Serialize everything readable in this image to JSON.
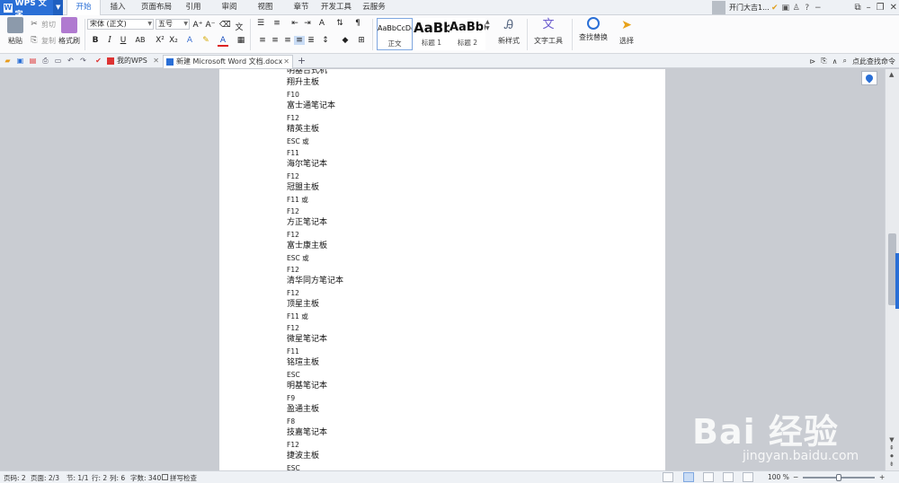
{
  "app": {
    "name": "WPS 文字"
  },
  "menu": {
    "tabs": [
      "开始",
      "插入",
      "页面布局",
      "引用",
      "审阅",
      "视图",
      "章节",
      "开发工具",
      "云服务"
    ],
    "active_tab": "开始"
  },
  "user": {
    "name": "开门大吉1..."
  },
  "ribbon": {
    "paste": "粘贴",
    "cut": "剪切",
    "copy": "复制",
    "format_painter": "格式刷",
    "font_name": "宋体 (正文)",
    "font_size": "五号",
    "styles": [
      {
        "preview": "AaBbCcDd",
        "label": "正文"
      },
      {
        "preview": "AaBb",
        "label": "标题 1"
      },
      {
        "preview": "AaBb(",
        "label": "标题 2"
      }
    ],
    "new_style": "新样式",
    "text_tools": "文字工具",
    "find_replace": "查找替换",
    "select": "选择"
  },
  "tabs_bar": {
    "my_wps": "我的WPS",
    "doc_name": "新建 Microsoft Word 文档.docx",
    "add": "+",
    "search_cmd": "点此查找命令"
  },
  "document": {
    "lines": [
      {
        "t": "明基台式机",
        "k": "cn"
      },
      {
        "t": "翔升主板",
        "k": "cn"
      },
      {
        "t": "F10",
        "k": "key"
      },
      {
        "t": "富士通笔记本",
        "k": "cn"
      },
      {
        "t": "F12",
        "k": "key"
      },
      {
        "t": "精英主板",
        "k": "cn"
      },
      {
        "t": "ESC 或",
        "k": "key"
      },
      {
        "t": "F11",
        "k": "key"
      },
      {
        "t": "海尔笔记本",
        "k": "cn"
      },
      {
        "t": "F12",
        "k": "key"
      },
      {
        "t": "冠盟主板",
        "k": "cn"
      },
      {
        "t": "F11 或",
        "k": "key"
      },
      {
        "t": "F12",
        "k": "key"
      },
      {
        "t": "方正笔记本",
        "k": "cn"
      },
      {
        "t": "F12",
        "k": "key"
      },
      {
        "t": "富士康主板",
        "k": "cn"
      },
      {
        "t": "ESC 或",
        "k": "key"
      },
      {
        "t": "F12",
        "k": "key"
      },
      {
        "t": "清华同方笔记本",
        "k": "cn"
      },
      {
        "t": "F12",
        "k": "key"
      },
      {
        "t": "顶星主板",
        "k": "cn"
      },
      {
        "t": "F11 或",
        "k": "key"
      },
      {
        "t": "F12",
        "k": "key"
      },
      {
        "t": "微星笔记本",
        "k": "cn"
      },
      {
        "t": "F11",
        "k": "key"
      },
      {
        "t": "铭瑄主板",
        "k": "cn"
      },
      {
        "t": "ESC",
        "k": "key"
      },
      {
        "t": "明基笔记本",
        "k": "cn"
      },
      {
        "t": "F9",
        "k": "key"
      },
      {
        "t": "盈通主板",
        "k": "cn"
      },
      {
        "t": "F8",
        "k": "key"
      },
      {
        "t": "技嘉笔记本",
        "k": "cn"
      },
      {
        "t": "F12",
        "k": "key"
      },
      {
        "t": "捷波主板",
        "k": "cn"
      },
      {
        "t": "ESC",
        "k": "key"
      }
    ]
  },
  "status": {
    "page_num": "页码: 2",
    "pages": "页面: 2/3",
    "section": "节: 1/1",
    "row": "行: 2",
    "col": "列: 6",
    "word_count": "字数: 340",
    "spell_check": "拼写检查",
    "zoom": "100 %",
    "zoom_level": 0.5
  },
  "watermark": {
    "text": "Bai 经验",
    "url": "jingyan.baidu.com"
  },
  "colors": {
    "accent": "#2a6fd6",
    "workspace": "#c9ccd2",
    "page": "#ffffff"
  },
  "icons": [
    "paste-icon",
    "cut-icon",
    "copy-icon",
    "format-painter-icon",
    "bold-icon",
    "italic-icon",
    "underline-icon",
    "find-replace-icon",
    "select-cursor-icon",
    "save-icon",
    "print-icon",
    "undo-icon",
    "redo-icon",
    "location-pin-icon"
  ]
}
